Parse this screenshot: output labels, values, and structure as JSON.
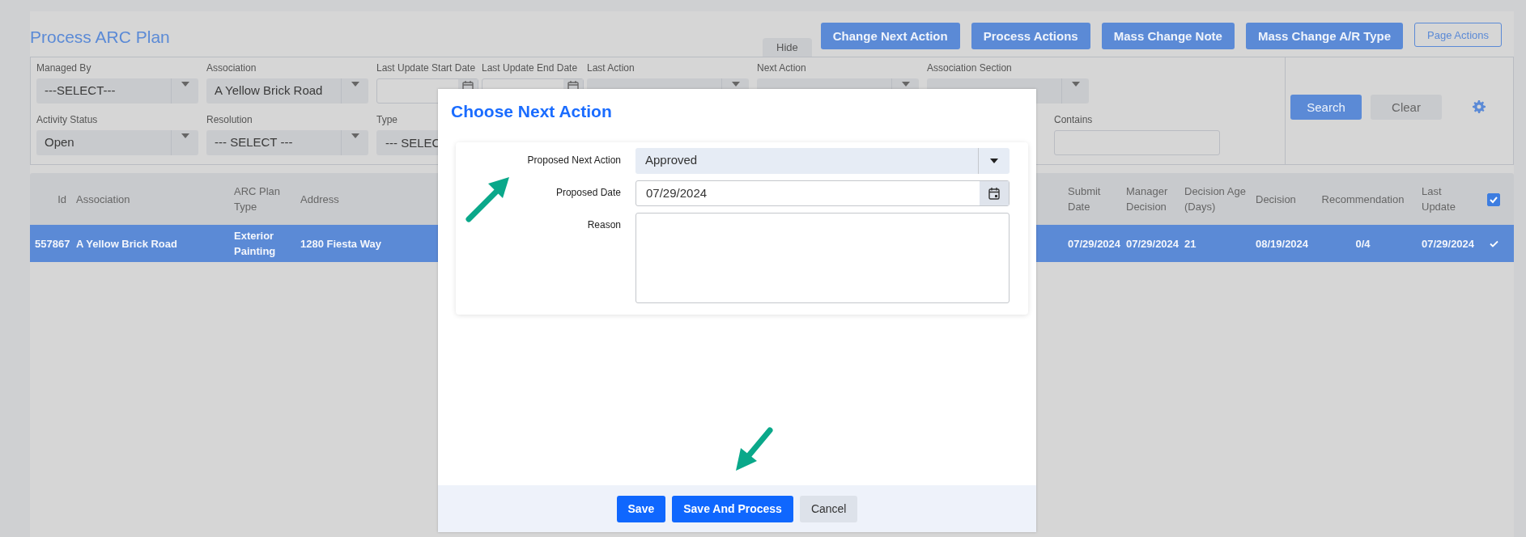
{
  "page": {
    "title": "Process ARC Plan"
  },
  "toolbar_buttons": [
    {
      "label": "Change Next Action",
      "kind": "primary"
    },
    {
      "label": "Process Actions",
      "kind": "primary"
    },
    {
      "label": "Mass Change Note",
      "kind": "primary"
    },
    {
      "label": "Mass Change A/R Type",
      "kind": "primary"
    },
    {
      "label": "Page Actions",
      "kind": "outline"
    }
  ],
  "hide_tab": {
    "label": "Hide"
  },
  "filters": {
    "row_1": [
      {
        "label": "Managed By",
        "kind": "select",
        "value": "---SELECT---"
      },
      {
        "label": "Association",
        "kind": "select",
        "value": "A Yellow Brick Road"
      },
      {
        "label": "Last Update Start Date",
        "kind": "date"
      },
      {
        "label": "Last Update End Date",
        "kind": "date"
      },
      {
        "label": "Last Action",
        "kind": "select"
      },
      {
        "label": "Next Action",
        "kind": "select"
      },
      {
        "label": "Association Section",
        "kind": "select"
      }
    ],
    "row_2": [
      {
        "label": "Activity Status",
        "kind": "select",
        "value": "Open"
      },
      {
        "label": "Resolution",
        "kind": "select",
        "value": "--- SELECT ---"
      },
      {
        "label": "Type",
        "kind": "text",
        "value": "--- SELEC"
      },
      {
        "label": "Contains",
        "kind": "text"
      }
    ],
    "actions": [
      {
        "label": "Search",
        "kind": "primary"
      },
      {
        "label": "Clear",
        "kind": "secondary"
      }
    ]
  },
  "table": {
    "columns": [
      {
        "label": "Id"
      },
      {
        "label": "Association"
      },
      {
        "label": "ARC Plan Type"
      },
      {
        "label": "Address"
      },
      {
        "label": "Submit Date"
      },
      {
        "label": "Manager Decision"
      },
      {
        "label": "Decision Age (Days)"
      },
      {
        "label": "Decision"
      },
      {
        "label": "Recommendation"
      },
      {
        "label": "Last Update"
      }
    ],
    "all_checked": true,
    "rows": [
      {
        "cells": [
          "557867",
          "A Yellow Brick Road",
          "Exterior Painting",
          "1280 Fiesta Way",
          "07/29/2024",
          "07/29/2024",
          "21",
          "08/19/2024",
          "0/4",
          "07/29/2024"
        ],
        "selected": true,
        "checked": true
      }
    ]
  },
  "modal": {
    "title": "Choose Next Action",
    "fields": [
      {
        "label": "Proposed Next Action",
        "kind": "select",
        "value": "Approved"
      },
      {
        "label": "Proposed Date",
        "kind": "date",
        "value": "07/29/2024"
      },
      {
        "label": "Reason",
        "kind": "textarea"
      }
    ],
    "buttons": [
      {
        "label": "Save",
        "kind": "primary"
      },
      {
        "label": "Save And Process",
        "kind": "primary"
      },
      {
        "label": "Cancel",
        "kind": "secondary"
      }
    ]
  }
}
